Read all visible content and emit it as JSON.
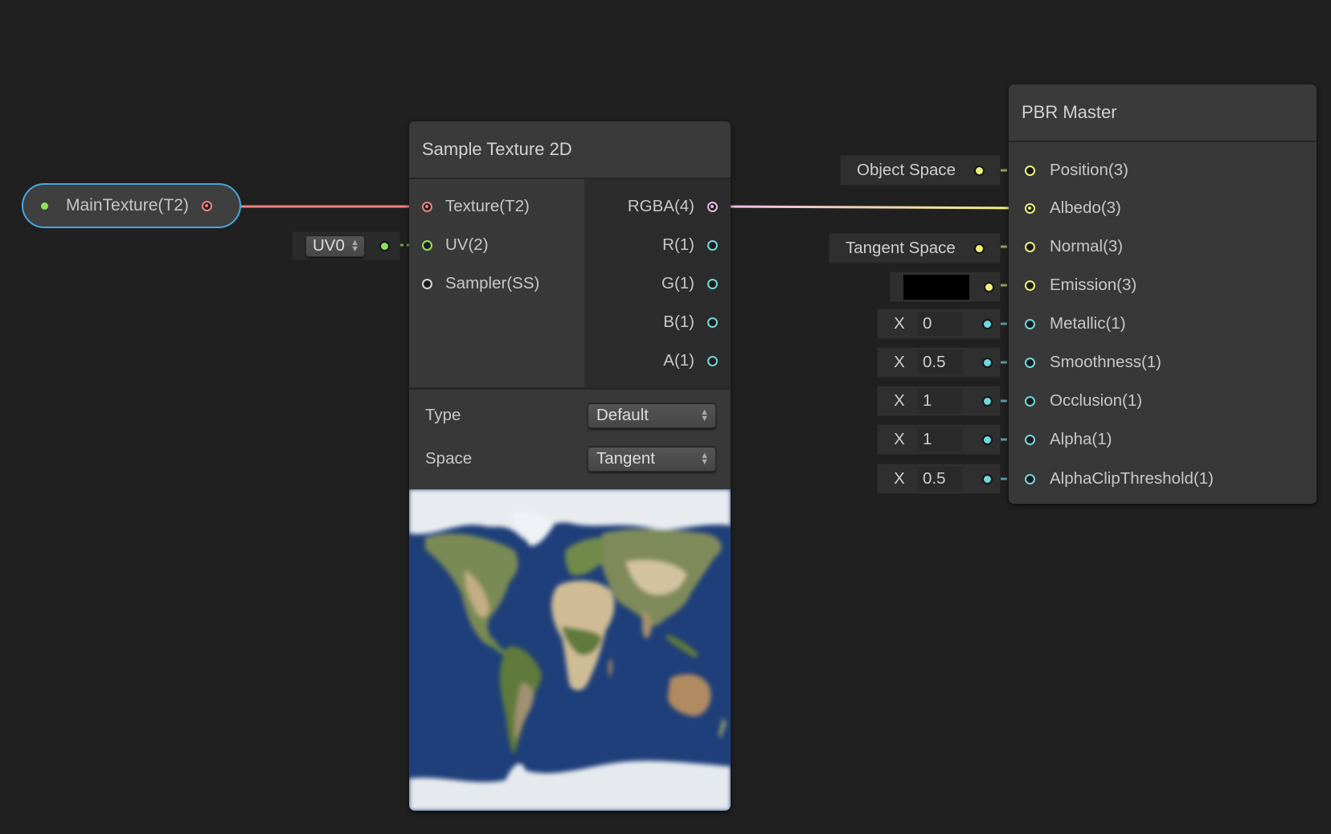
{
  "property_node": {
    "label": "MainTexture(T2)",
    "colors": {
      "outline": "#46a7dc",
      "port": "#f08080",
      "dot": "#8ee05a"
    }
  },
  "uv_control": {
    "value": "UV0",
    "icon": "updown-arrows-icon"
  },
  "sample_node": {
    "title": "Sample Texture 2D",
    "inputs": [
      {
        "label": "Texture(T2)",
        "color": "#f08080",
        "connected": true
      },
      {
        "label": "UV(2)",
        "color": "#8ee05a",
        "connected": false
      },
      {
        "label": "Sampler(SS)",
        "color": "#d8d8d8",
        "connected": false
      }
    ],
    "outputs": [
      {
        "label": "RGBA(4)",
        "color": "#f0b8e8",
        "connected": true
      },
      {
        "label": "R(1)",
        "color": "#6fd8dc",
        "connected": false
      },
      {
        "label": "G(1)",
        "color": "#6fd8dc",
        "connected": false
      },
      {
        "label": "B(1)",
        "color": "#6fd8dc",
        "connected": false
      },
      {
        "label": "A(1)",
        "color": "#6fd8dc",
        "connected": false
      }
    ],
    "controls": [
      {
        "label": "Type",
        "value": "Default"
      },
      {
        "label": "Space",
        "value": "Tangent"
      }
    ],
    "preview": "world-map-texture"
  },
  "pbr_node": {
    "title": "PBR Master",
    "inputs": [
      {
        "label": "Position(3)",
        "color": "#eef07a",
        "default": {
          "kind": "text",
          "value": "Object Space"
        },
        "connected": false
      },
      {
        "label": "Albedo(3)",
        "color": "#eef07a",
        "default": null,
        "connected": true
      },
      {
        "label": "Normal(3)",
        "color": "#eef07a",
        "default": {
          "kind": "text",
          "value": "Tangent Space"
        },
        "connected": false
      },
      {
        "label": "Emission(3)",
        "color": "#eef07a",
        "default": {
          "kind": "color",
          "value": "#000000"
        },
        "connected": false
      },
      {
        "label": "Metallic(1)",
        "color": "#6fd8dc",
        "default": {
          "kind": "float",
          "axis": "X",
          "value": "0"
        },
        "connected": false
      },
      {
        "label": "Smoothness(1)",
        "color": "#6fd8dc",
        "default": {
          "kind": "float",
          "axis": "X",
          "value": "0.5"
        },
        "connected": false
      },
      {
        "label": "Occlusion(1)",
        "color": "#6fd8dc",
        "default": {
          "kind": "float",
          "axis": "X",
          "value": "1"
        },
        "connected": false
      },
      {
        "label": "Alpha(1)",
        "color": "#6fd8dc",
        "default": {
          "kind": "float",
          "axis": "X",
          "value": "1"
        },
        "connected": false
      },
      {
        "label": "AlphaClipThreshold(1)",
        "color": "#6fd8dc",
        "default": {
          "kind": "float",
          "axis": "X",
          "value": "0.5"
        },
        "connected": false
      }
    ]
  },
  "edges": [
    {
      "from": "MainTexture(T2)",
      "to": "Texture(T2)",
      "color": "#f08080"
    },
    {
      "from": "RGBA(4)",
      "to": "Albedo(3)",
      "color_from": "#f0b8e8",
      "color_to": "#eef07a"
    }
  ]
}
